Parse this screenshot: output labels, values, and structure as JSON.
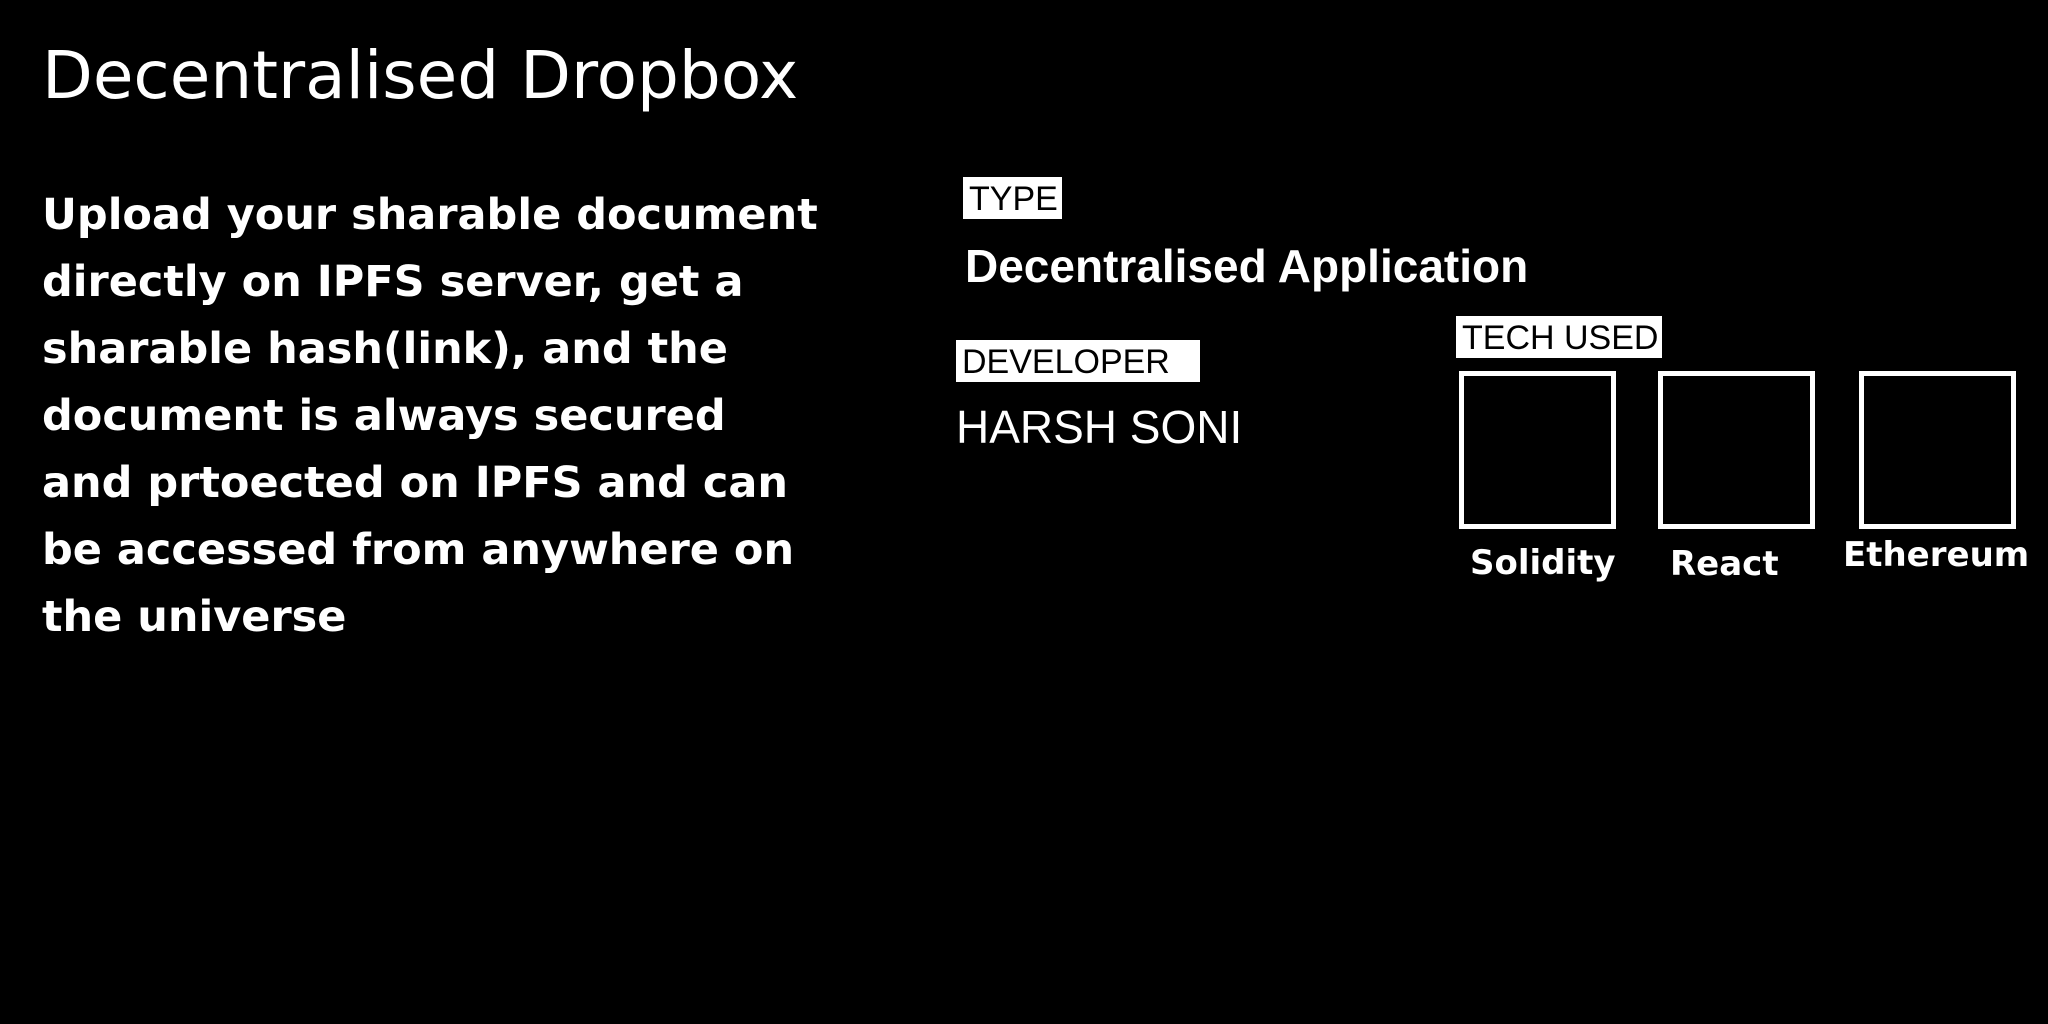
{
  "title": "Decentralised Dropbox",
  "description": {
    "lines": [
      "Upload your sharable document",
      "directly on IPFS server, get a",
      "sharable hash(link), and the",
      "document is always secured",
      "and prtoected on IPFS and can",
      "be accessed from anywhere on",
      "the universe"
    ]
  },
  "type": {
    "label": "TYPE",
    "value": "Decentralised Application"
  },
  "developer": {
    "label": "DEVELOPER",
    "value": "HARSH SONI"
  },
  "tech_used": {
    "label": "TECH USED",
    "items": [
      {
        "name": "Solidity"
      },
      {
        "name": "React"
      },
      {
        "name": "Ethereum"
      }
    ]
  },
  "colors": {
    "background": "#000000",
    "foreground": "#ffffff"
  }
}
